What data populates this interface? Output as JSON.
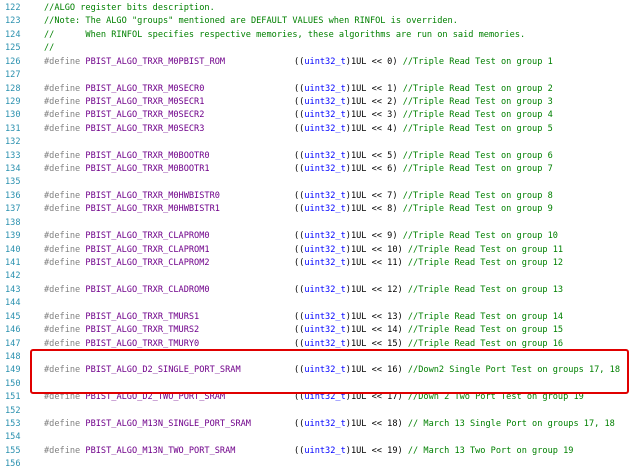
{
  "editor": {
    "lines": [
      {
        "n": "122",
        "kind": "comment",
        "text": "//ALGO register bits description."
      },
      {
        "n": "123",
        "kind": "comment",
        "text": "//Note: The ALGO \"groups\" mentioned are DEFAULT VALUES when RINFOL is overriden."
      },
      {
        "n": "124",
        "kind": "comment",
        "text": "//      When RINFOL specifies respective memories, these algorithms are run on said memories."
      },
      {
        "n": "125",
        "kind": "comment",
        "text": "//"
      },
      {
        "n": "126",
        "kind": "define",
        "name": "PBIST_ALGO_TRXR_M0PBIST_ROM",
        "expr_pre": "((",
        "type": "uint32_t",
        "expr_post": ")1UL << 0)",
        "comment": "//Triple Read Test on group 1"
      },
      {
        "n": "127",
        "kind": "blank"
      },
      {
        "n": "128",
        "kind": "define",
        "name": "PBIST_ALGO_TRXR_M0SECR0",
        "expr_pre": "((",
        "type": "uint32_t",
        "expr_post": ")1UL << 1)",
        "comment": "//Triple Read Test on group 2"
      },
      {
        "n": "129",
        "kind": "define",
        "name": "PBIST_ALGO_TRXR_M0SECR1",
        "expr_pre": "((",
        "type": "uint32_t",
        "expr_post": ")1UL << 2)",
        "comment": "//Triple Read Test on group 3"
      },
      {
        "n": "130",
        "kind": "define",
        "name": "PBIST_ALGO_TRXR_M0SECR2",
        "expr_pre": "((",
        "type": "uint32_t",
        "expr_post": ")1UL << 3)",
        "comment": "//Triple Read Test on group 4"
      },
      {
        "n": "131",
        "kind": "define",
        "name": "PBIST_ALGO_TRXR_M0SECR3",
        "expr_pre": "((",
        "type": "uint32_t",
        "expr_post": ")1UL << 4)",
        "comment": "//Triple Read Test on group 5"
      },
      {
        "n": "132",
        "kind": "blank"
      },
      {
        "n": "133",
        "kind": "define",
        "name": "PBIST_ALGO_TRXR_M0BOOTR0",
        "expr_pre": "((",
        "type": "uint32_t",
        "expr_post": ")1UL << 5)",
        "comment": "//Triple Read Test on group 6"
      },
      {
        "n": "134",
        "kind": "define",
        "name": "PBIST_ALGO_TRXR_M0BOOTR1",
        "expr_pre": "((",
        "type": "uint32_t",
        "expr_post": ")1UL << 6)",
        "comment": "//Triple Read Test on group 7"
      },
      {
        "n": "135",
        "kind": "blank"
      },
      {
        "n": "136",
        "kind": "define",
        "name": "PBIST_ALGO_TRXR_M0HWBISTR0",
        "expr_pre": "((",
        "type": "uint32_t",
        "expr_post": ")1UL << 7)",
        "comment": "//Triple Read Test on group 8"
      },
      {
        "n": "137",
        "kind": "define",
        "name": "PBIST_ALGO_TRXR_M0HWBISTR1",
        "expr_pre": "((",
        "type": "uint32_t",
        "expr_post": ")1UL << 8)",
        "comment": "//Triple Read Test on group 9"
      },
      {
        "n": "138",
        "kind": "blank"
      },
      {
        "n": "139",
        "kind": "define",
        "name": "PBIST_ALGO_TRXR_CLAPROM0",
        "expr_pre": "((",
        "type": "uint32_t",
        "expr_post": ")1UL << 9)",
        "comment": "//Triple Read Test on group 10"
      },
      {
        "n": "140",
        "kind": "define",
        "name": "PBIST_ALGO_TRXR_CLAPROM1",
        "expr_pre": "((",
        "type": "uint32_t",
        "expr_post": ")1UL << 10)",
        "comment": "//Triple Read Test on group 11"
      },
      {
        "n": "141",
        "kind": "define",
        "name": "PBIST_ALGO_TRXR_CLAPROM2",
        "expr_pre": "((",
        "type": "uint32_t",
        "expr_post": ")1UL << 11)",
        "comment": "//Triple Read Test on group 12"
      },
      {
        "n": "142",
        "kind": "blank"
      },
      {
        "n": "143",
        "kind": "define",
        "name": "PBIST_ALGO_TRXR_CLADROM0",
        "expr_pre": "((",
        "type": "uint32_t",
        "expr_post": ")1UL << 12)",
        "comment": "//Triple Read Test on group 13"
      },
      {
        "n": "144",
        "kind": "blank"
      },
      {
        "n": "145",
        "kind": "define",
        "name": "PBIST_ALGO_TRXR_TMURS1",
        "expr_pre": "((",
        "type": "uint32_t",
        "expr_post": ")1UL << 13)",
        "comment": "//Triple Read Test on group 14"
      },
      {
        "n": "146",
        "kind": "define",
        "name": "PBIST_ALGO_TRXR_TMURS2",
        "expr_pre": "((",
        "type": "uint32_t",
        "expr_post": ")1UL << 14)",
        "comment": "//Triple Read Test on group 15"
      },
      {
        "n": "147",
        "kind": "define",
        "name": "PBIST_ALGO_TRXR_TMURY0",
        "expr_pre": "((",
        "type": "uint32_t",
        "expr_post": ")1UL << 15)",
        "comment": "//Triple Read Test on group 16"
      },
      {
        "n": "148",
        "kind": "blank"
      },
      {
        "n": "149",
        "kind": "define",
        "name": "PBIST_ALGO_D2_SINGLE_PORT_SRAM",
        "expr_pre": "((",
        "type": "uint32_t",
        "expr_post": ")1UL << 16)",
        "comment": "//Down2 Single Port Test on groups 17, 18"
      },
      {
        "n": "150",
        "kind": "blank"
      },
      {
        "n": "151",
        "kind": "define",
        "name": "PBIST_ALGO_D2_TWO_PORT_SRAM",
        "expr_pre": "((",
        "type": "uint32_t",
        "expr_post": ")1UL << 17)",
        "comment": "//Down 2 Two Port Test on group 19"
      },
      {
        "n": "152",
        "kind": "blank"
      },
      {
        "n": "153",
        "kind": "define",
        "name": "PBIST_ALGO_M13N_SINGLE_PORT_SRAM",
        "expr_pre": "((",
        "type": "uint32_t",
        "expr_post": ")1UL << 18)",
        "comment": "// March 13 Single Port on groups 17, 18"
      },
      {
        "n": "154",
        "kind": "blank"
      },
      {
        "n": "155",
        "kind": "blank"
      },
      {
        "n": "156",
        "kind": "blank"
      },
      {
        "n": "",
        "kind": "define",
        "name": "PBIST_ALGO_M13N_TWO_PORT_SRAM",
        "expr_pre": "((",
        "type": "uint32_t",
        "expr_post": ")1UL << 19)",
        "comment": "// March 13 Two Port on group 19"
      }
    ],
    "define_keyword": "#define",
    "highlight_color": "#e00000"
  }
}
